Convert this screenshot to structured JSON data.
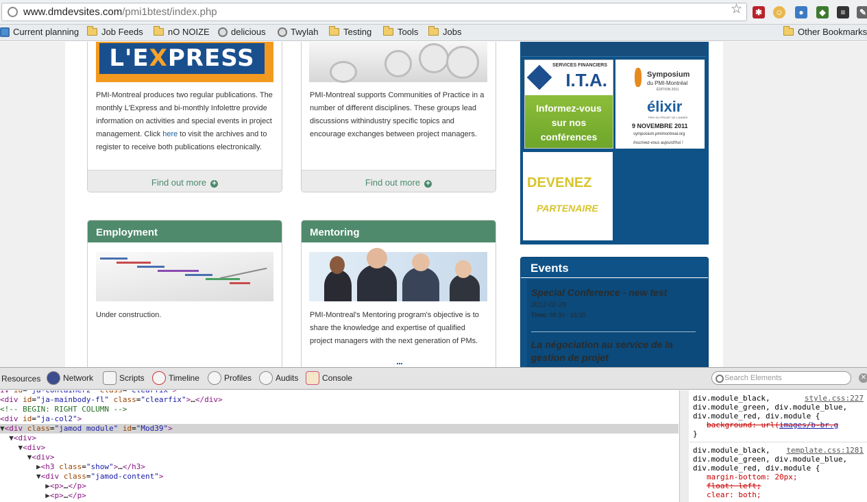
{
  "browser": {
    "url_host": "www.dmdevsites.com",
    "url_path": "/pmi1btest/index.php"
  },
  "bookmarks": [
    {
      "label": "Current planning",
      "type": "folder"
    },
    {
      "label": "Job Feeds",
      "type": "folder"
    },
    {
      "label": "nO NOIZE",
      "type": "folder"
    },
    {
      "label": "delicious",
      "type": "site"
    },
    {
      "label": "Twylah",
      "type": "site"
    },
    {
      "label": "Testing",
      "type": "folder"
    },
    {
      "label": "Tools",
      "type": "folder"
    },
    {
      "label": "Jobs",
      "type": "folder"
    },
    {
      "label": "Other Bookmarks",
      "type": "folder"
    }
  ],
  "page": {
    "express": {
      "logo": "L'EXPRESS",
      "text_before_link": "PMI-Montreal produces two regular publications. The monthly L'Express and bi-monthly Infolettre provide information on activities and special events in project management. Click ",
      "link": "here",
      "text_after_link": " to visit the archives and to register to receive both publications electronically.",
      "find_more": "Find out more"
    },
    "communities": {
      "text": "PMI-Montreal supports Communities of Practice in a number of different disciplines. These groups lead discussions withindustry specific topics and encourage exchanges between project managers.",
      "find_more": "Find out more"
    },
    "employment": {
      "title": "Employment",
      "text": "Under construction."
    },
    "mentoring": {
      "title": "Mentoring",
      "text": "PMI-Montreal's Mentoring program's objective is to share the knowledge and expertise of qualified project managers with the next generation of PMs."
    },
    "ads": {
      "ita_small": "SERVICES FINANCIERS",
      "ita_big": "I.T.A.",
      "ita_line1": "Informez-vous",
      "ita_line2": "sur nos",
      "ita_line3": "conférences",
      "symposium_title": "Symposium",
      "symposium_sub": "du PMI-Montréal",
      "symposium_edition": "ÉDITION 2011",
      "symposium_brand": "élixir",
      "symposium_tagline": "PRIX DU PROJET DE L'ANNÉE",
      "symposium_date": "9 NOVEMBRE 2011",
      "symposium_site": "symposium.pmimontreal.org",
      "symposium_cta": "Inscrivez-vous aujourd'hui !",
      "devenez": "DEVENEZ",
      "partenaire": "PARTENAIRE"
    },
    "events": {
      "title": "Events",
      "items": [
        {
          "title": "Special Conference - new test",
          "date": "2012-02-29",
          "time_label": "Time:",
          "time": "08:30 - 16:30"
        },
        {
          "title": "La négociation au service de la gestion de projet"
        }
      ]
    }
  },
  "devtools": {
    "tabs": [
      "Resources",
      "Network",
      "Scripts",
      "Timeline",
      "Profiles",
      "Audits",
      "Console"
    ],
    "search_placeholder": "Search Elements",
    "styles": [
      {
        "selector": "div.module_black, div.module_green, div.module_blue, div.module_red, div.module {",
        "source": "style.css:227",
        "prop": "background",
        "value_before": "url(",
        "value_link": "images/b-br.g",
        "close": "}"
      },
      {
        "selector": "div.module_black, div.module_green, div.module_blue, div.module_red, div.module {",
        "source": "template.css:1281",
        "props": [
          "margin-bottom: 20px;",
          "float: left;",
          "clear: both;"
        ]
      }
    ]
  },
  "colors": {
    "green_header": "#4f8a6c",
    "sidebar_blue": "#0f5287",
    "express_orange": "#f29a1f"
  }
}
